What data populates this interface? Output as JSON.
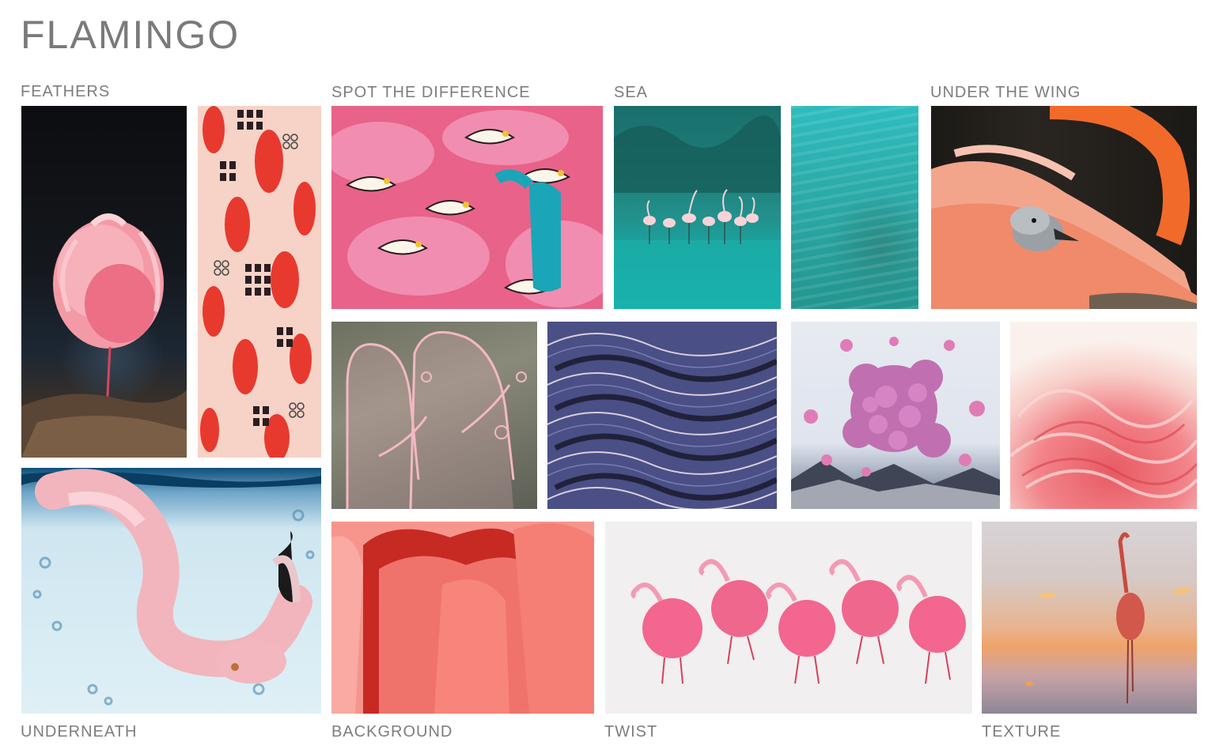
{
  "title": "FLAMINGO",
  "sections": {
    "feathers": "FEATHERS",
    "spot": "SPOT THE DIFFERENCE",
    "sea": "SEA",
    "wing": "UNDER THE WING",
    "underneath": "UNDERNEATH",
    "background": "BACKGROUND",
    "twist": "TWIST",
    "texture": "TEXTURE"
  },
  "colors": {
    "label_gray": "#7d7d7d",
    "flamingo_pink": "#f07a8a",
    "coral": "#f1877f",
    "teal": "#1aa4a0"
  }
}
